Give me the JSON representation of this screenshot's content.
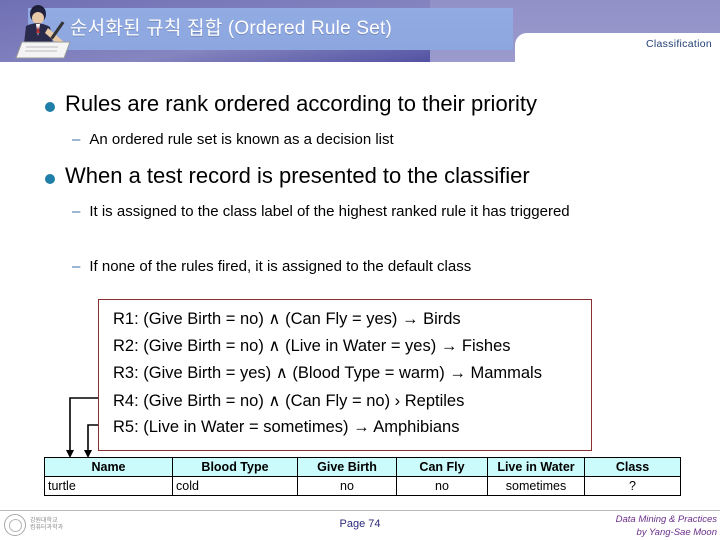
{
  "header": {
    "title": "순서화된 규칙 집합 (Ordered Rule Set)",
    "classification_label": "Classification",
    "writer_icon": "person-writing-icon",
    "band_color": "#8ca6e0",
    "gradient_from": "#6f6fb5",
    "gradient_to": "#2d2d86"
  },
  "content": {
    "bullets": [
      {
        "level": 1,
        "text": "Rules are rank ordered according to their priority",
        "bullet_glyph": "filled-circle",
        "bullet_color": "#1f7fa8"
      },
      {
        "level": 2,
        "text": "An ordered rule set is known as a decision list",
        "bullet_glyph": "dash"
      },
      {
        "level": 1,
        "text": "When a test record is presented to the classifier",
        "bullet_glyph": "filled-circle",
        "bullet_color": "#1f7fa8"
      },
      {
        "level": 2,
        "text": "It is assigned to the class label of the highest ranked rule it has triggered",
        "bullet_glyph": "dash"
      },
      {
        "level": 2,
        "text": "If none of the rules fired, it is assigned to the default class",
        "bullet_glyph": "dash"
      }
    ]
  },
  "rule_box": {
    "border_color": "#8a2f2f",
    "rules": [
      "R1: (Give Birth = no) ∧ (Can Fly = yes) → Birds",
      "R2: (Give Birth = no) ∧ (Live in Water = yes) → Fishes",
      "R3: (Give Birth = yes) ∧ (Blood Type = warm) → Mammals",
      "R4: (Give Birth = no) ∧ (Can Fly = no)  › Reptiles",
      "R5: (Live in Water = sometimes) → Amphibians"
    ]
  },
  "table": {
    "header_bg": "#ccfbfb",
    "columns": [
      "Name",
      "Blood Type",
      "Give Birth",
      "Can Fly",
      "Live in Water",
      "Class"
    ],
    "rows": [
      [
        "turtle",
        "cold",
        "no",
        "no",
        "sometimes",
        "?"
      ]
    ]
  },
  "footer": {
    "page_label": "Page 74",
    "credit_line_1": "Data Mining & Practices",
    "credit_line_2": "by Yang-Sae Moon",
    "logo_line_1": "강원대학교",
    "logo_line_2": "컴퓨터과학과",
    "logo_icon": "university-seal-icon"
  }
}
